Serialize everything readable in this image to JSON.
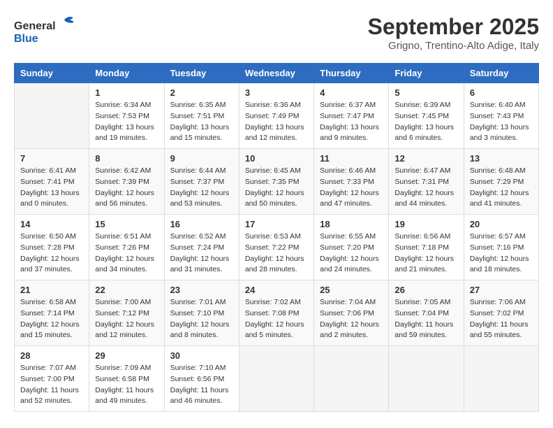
{
  "logo": {
    "general": "General",
    "blue": "Blue"
  },
  "title": "September 2025",
  "location": "Grigno, Trentino-Alto Adige, Italy",
  "days": [
    "Sunday",
    "Monday",
    "Tuesday",
    "Wednesday",
    "Thursday",
    "Friday",
    "Saturday"
  ],
  "weeks": [
    [
      {
        "day": null,
        "info": null
      },
      {
        "day": "1",
        "sunrise": "6:34 AM",
        "sunset": "7:53 PM",
        "daylight": "13 hours and 19 minutes."
      },
      {
        "day": "2",
        "sunrise": "6:35 AM",
        "sunset": "7:51 PM",
        "daylight": "13 hours and 15 minutes."
      },
      {
        "day": "3",
        "sunrise": "6:36 AM",
        "sunset": "7:49 PM",
        "daylight": "13 hours and 12 minutes."
      },
      {
        "day": "4",
        "sunrise": "6:37 AM",
        "sunset": "7:47 PM",
        "daylight": "13 hours and 9 minutes."
      },
      {
        "day": "5",
        "sunrise": "6:39 AM",
        "sunset": "7:45 PM",
        "daylight": "13 hours and 6 minutes."
      },
      {
        "day": "6",
        "sunrise": "6:40 AM",
        "sunset": "7:43 PM",
        "daylight": "13 hours and 3 minutes."
      }
    ],
    [
      {
        "day": "7",
        "sunrise": "6:41 AM",
        "sunset": "7:41 PM",
        "daylight": "13 hours and 0 minutes."
      },
      {
        "day": "8",
        "sunrise": "6:42 AM",
        "sunset": "7:39 PM",
        "daylight": "12 hours and 56 minutes."
      },
      {
        "day": "9",
        "sunrise": "6:44 AM",
        "sunset": "7:37 PM",
        "daylight": "12 hours and 53 minutes."
      },
      {
        "day": "10",
        "sunrise": "6:45 AM",
        "sunset": "7:35 PM",
        "daylight": "12 hours and 50 minutes."
      },
      {
        "day": "11",
        "sunrise": "6:46 AM",
        "sunset": "7:33 PM",
        "daylight": "12 hours and 47 minutes."
      },
      {
        "day": "12",
        "sunrise": "6:47 AM",
        "sunset": "7:31 PM",
        "daylight": "12 hours and 44 minutes."
      },
      {
        "day": "13",
        "sunrise": "6:48 AM",
        "sunset": "7:29 PM",
        "daylight": "12 hours and 41 minutes."
      }
    ],
    [
      {
        "day": "14",
        "sunrise": "6:50 AM",
        "sunset": "7:28 PM",
        "daylight": "12 hours and 37 minutes."
      },
      {
        "day": "15",
        "sunrise": "6:51 AM",
        "sunset": "7:26 PM",
        "daylight": "12 hours and 34 minutes."
      },
      {
        "day": "16",
        "sunrise": "6:52 AM",
        "sunset": "7:24 PM",
        "daylight": "12 hours and 31 minutes."
      },
      {
        "day": "17",
        "sunrise": "6:53 AM",
        "sunset": "7:22 PM",
        "daylight": "12 hours and 28 minutes."
      },
      {
        "day": "18",
        "sunrise": "6:55 AM",
        "sunset": "7:20 PM",
        "daylight": "12 hours and 24 minutes."
      },
      {
        "day": "19",
        "sunrise": "6:56 AM",
        "sunset": "7:18 PM",
        "daylight": "12 hours and 21 minutes."
      },
      {
        "day": "20",
        "sunrise": "6:57 AM",
        "sunset": "7:16 PM",
        "daylight": "12 hours and 18 minutes."
      }
    ],
    [
      {
        "day": "21",
        "sunrise": "6:58 AM",
        "sunset": "7:14 PM",
        "daylight": "12 hours and 15 minutes."
      },
      {
        "day": "22",
        "sunrise": "7:00 AM",
        "sunset": "7:12 PM",
        "daylight": "12 hours and 12 minutes."
      },
      {
        "day": "23",
        "sunrise": "7:01 AM",
        "sunset": "7:10 PM",
        "daylight": "12 hours and 8 minutes."
      },
      {
        "day": "24",
        "sunrise": "7:02 AM",
        "sunset": "7:08 PM",
        "daylight": "12 hours and 5 minutes."
      },
      {
        "day": "25",
        "sunrise": "7:04 AM",
        "sunset": "7:06 PM",
        "daylight": "12 hours and 2 minutes."
      },
      {
        "day": "26",
        "sunrise": "7:05 AM",
        "sunset": "7:04 PM",
        "daylight": "11 hours and 59 minutes."
      },
      {
        "day": "27",
        "sunrise": "7:06 AM",
        "sunset": "7:02 PM",
        "daylight": "11 hours and 55 minutes."
      }
    ],
    [
      {
        "day": "28",
        "sunrise": "7:07 AM",
        "sunset": "7:00 PM",
        "daylight": "11 hours and 52 minutes."
      },
      {
        "day": "29",
        "sunrise": "7:09 AM",
        "sunset": "6:58 PM",
        "daylight": "11 hours and 49 minutes."
      },
      {
        "day": "30",
        "sunrise": "7:10 AM",
        "sunset": "6:56 PM",
        "daylight": "11 hours and 46 minutes."
      },
      {
        "day": null,
        "info": null
      },
      {
        "day": null,
        "info": null
      },
      {
        "day": null,
        "info": null
      },
      {
        "day": null,
        "info": null
      }
    ]
  ]
}
